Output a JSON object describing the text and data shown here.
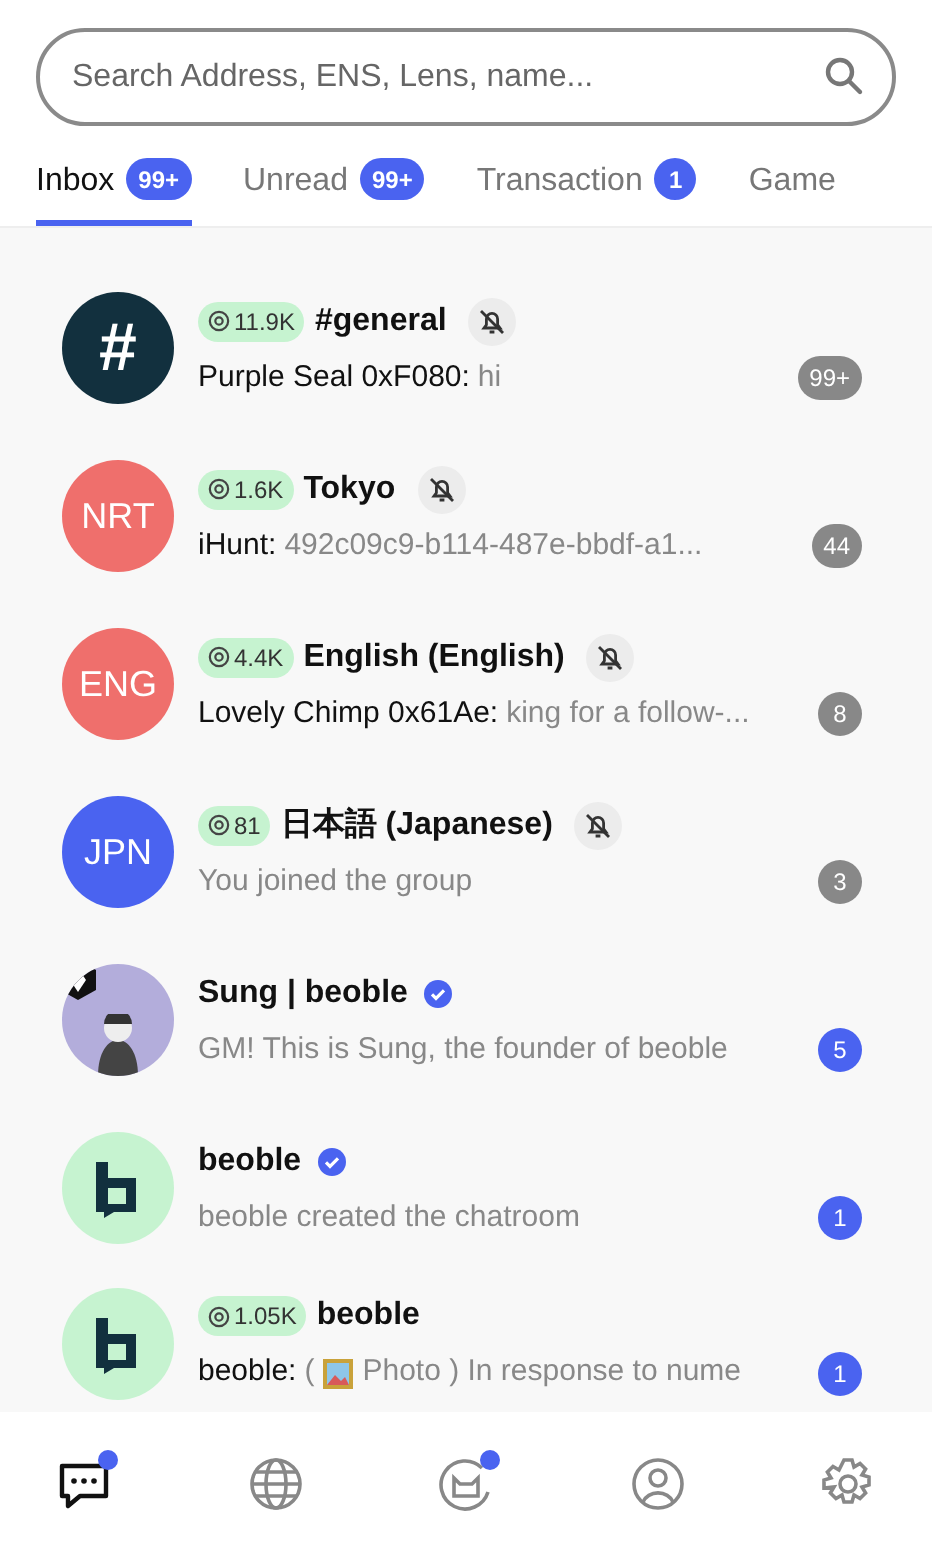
{
  "search": {
    "placeholder": "Search Address, ENS, Lens, name..."
  },
  "tabs": [
    {
      "label": "Inbox",
      "badge": "99+",
      "selected": true
    },
    {
      "label": "Unread",
      "badge": "99+",
      "selected": false
    },
    {
      "label": "Transaction",
      "badge": "1",
      "selected": false
    },
    {
      "label": "Game",
      "selected": false
    }
  ],
  "chats": [
    {
      "avatar": {
        "kind": "text",
        "text": "#",
        "color": "#12303e"
      },
      "members": "11.9K",
      "name": "#general",
      "muted": true,
      "verified": false,
      "sender": "Purple Seal 0xF080:",
      "message": "hi",
      "unread": "99+"
    },
    {
      "avatar": {
        "kind": "text",
        "text": "NRT",
        "color": "#ef6f6c"
      },
      "members": "1.6K",
      "name": "Tokyo",
      "muted": true,
      "verified": false,
      "sender": "iHunt:",
      "message": "492c09c9-b114-487e-bbdf-a1...",
      "unread": "44"
    },
    {
      "avatar": {
        "kind": "text",
        "text": "ENG",
        "color": "#ef6f6c"
      },
      "members": "4.4K",
      "name": "English (English)",
      "muted": true,
      "verified": false,
      "sender": "Lovely Chimp 0x61Ae:",
      "message": "king for a follow-...",
      "unread": "8"
    },
    {
      "avatar": {
        "kind": "text",
        "text": "JPN",
        "color": "#4a63f0"
      },
      "members": "81",
      "name": "日本語 (Japanese)",
      "muted": true,
      "verified": false,
      "message": "You joined the group",
      "unread": "3"
    },
    {
      "avatar": {
        "kind": "figure",
        "color": "#b3addb"
      },
      "name": "Sung | beoble",
      "muted": false,
      "verified": true,
      "message": "GM! This is Sung, the founder of beoble",
      "unread": "5"
    },
    {
      "avatar": {
        "kind": "logo",
        "color": "#c6f3d0"
      },
      "name": "beoble",
      "muted": false,
      "verified": true,
      "message": "beoble created the chatroom",
      "unread": "1"
    },
    {
      "avatar": {
        "kind": "logo",
        "color": "#c6f3d0"
      },
      "members": "1.05K",
      "name": "beoble",
      "muted": false,
      "verified": false,
      "sender": "beoble:",
      "attachment": {
        "kind": "photo",
        "before": "("
      },
      "message": "Photo ) In response to nume",
      "unread": "1"
    }
  ],
  "nav": [
    {
      "kind": "chat",
      "selected": true,
      "dot": true
    },
    {
      "kind": "globe",
      "selected": false,
      "dot": false
    },
    {
      "kind": "cat",
      "selected": false,
      "dot": true
    },
    {
      "kind": "profile",
      "selected": false,
      "dot": false
    },
    {
      "kind": "settings",
      "selected": false,
      "dot": false
    }
  ]
}
